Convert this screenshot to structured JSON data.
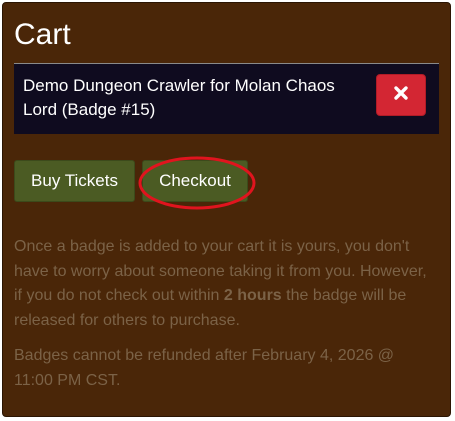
{
  "cart": {
    "title": "Cart",
    "item": {
      "name": "Demo Dungeon Crawler for Molan Chaos Lord (Badge #15)",
      "remove_icon": "close-icon"
    },
    "buttons": {
      "buy_tickets": "Buy Tickets",
      "checkout": "Checkout"
    },
    "info": {
      "hold_before": "Once a badge is added to your cart it is yours, you don't have to worry about someone taking it from you. However, if you do not check out within ",
      "hold_duration": "2 hours",
      "hold_after": " the badge will be released for others to purchase.",
      "refund": "Badges cannot be refunded after February 4, 2026 @ 11:00 PM CST."
    }
  },
  "colors": {
    "panel_bg": "#4a2608",
    "item_bg": "#0f0b1f",
    "remove_bg": "#d32633",
    "button_bg": "#4b5b23",
    "highlight_circle": "#e0141e",
    "info_text": "#7b6247"
  }
}
